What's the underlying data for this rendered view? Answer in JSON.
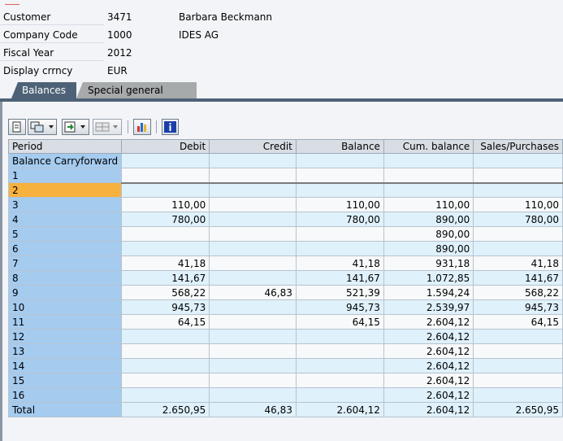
{
  "header": {
    "customer": {
      "label": "Customer",
      "value": "3471",
      "extra": "Barbara Beckmann"
    },
    "company_code": {
      "label": "Company Code",
      "value": "1000",
      "extra": "IDES AG"
    },
    "fiscal_year": {
      "label": "Fiscal Year",
      "value": "2012"
    },
    "display_currency": {
      "label": "Display crrncy",
      "value": "EUR"
    }
  },
  "tabs": [
    {
      "label": "Balances",
      "active": true
    },
    {
      "label": "Special general ledger",
      "active": false
    }
  ],
  "toolbar": {
    "icons": [
      "print-icon",
      "filter-icon",
      "export-icon",
      "layout-icon",
      "chart-icon",
      "info-icon"
    ]
  },
  "table": {
    "columns": [
      "Period",
      "Debit",
      "Credit",
      "Balance",
      "Cum. balance",
      "Sales/Purchases"
    ],
    "rows": [
      {
        "period": "Balance Carryforward",
        "debit": "",
        "credit": "",
        "balance": "",
        "cum": "",
        "sales": ""
      },
      {
        "period": "1",
        "debit": "",
        "credit": "",
        "balance": "",
        "cum": "",
        "sales": ""
      },
      {
        "period": "2",
        "debit": "",
        "credit": "",
        "balance": "",
        "cum": "",
        "sales": "",
        "selected": true
      },
      {
        "period": "3",
        "debit": "110,00",
        "credit": "",
        "balance": "110,00",
        "cum": "110,00",
        "sales": "110,00"
      },
      {
        "period": "4",
        "debit": "780,00",
        "credit": "",
        "balance": "780,00",
        "cum": "890,00",
        "sales": "780,00"
      },
      {
        "period": "5",
        "debit": "",
        "credit": "",
        "balance": "",
        "cum": "890,00",
        "sales": ""
      },
      {
        "period": "6",
        "debit": "",
        "credit": "",
        "balance": "",
        "cum": "890,00",
        "sales": ""
      },
      {
        "period": "7",
        "debit": "41,18",
        "credit": "",
        "balance": "41,18",
        "cum": "931,18",
        "sales": "41,18"
      },
      {
        "period": "8",
        "debit": "141,67",
        "credit": "",
        "balance": "141,67",
        "cum": "1.072,85",
        "sales": "141,67"
      },
      {
        "period": "9",
        "debit": "568,22",
        "credit": "46,83",
        "balance": "521,39",
        "cum": "1.594,24",
        "sales": "568,22"
      },
      {
        "period": "10",
        "debit": "945,73",
        "credit": "",
        "balance": "945,73",
        "cum": "2.539,97",
        "sales": "945,73"
      },
      {
        "period": "11",
        "debit": "64,15",
        "credit": "",
        "balance": "64,15",
        "cum": "2.604,12",
        "sales": "64,15"
      },
      {
        "period": "12",
        "debit": "",
        "credit": "",
        "balance": "",
        "cum": "2.604,12",
        "sales": ""
      },
      {
        "period": "13",
        "debit": "",
        "credit": "",
        "balance": "",
        "cum": "2.604,12",
        "sales": ""
      },
      {
        "period": "14",
        "debit": "",
        "credit": "",
        "balance": "",
        "cum": "2.604,12",
        "sales": ""
      },
      {
        "period": "15",
        "debit": "",
        "credit": "",
        "balance": "",
        "cum": "2.604,12",
        "sales": ""
      },
      {
        "period": "16",
        "debit": "",
        "credit": "",
        "balance": "",
        "cum": "2.604,12",
        "sales": ""
      },
      {
        "period": "Total",
        "debit": "2.650,95",
        "credit": "46,83",
        "balance": "2.604,12",
        "cum": "2.604,12",
        "sales": "2.650,95",
        "total": true
      }
    ]
  },
  "colors": {
    "period_column": "#a5cbef",
    "selected_row": "#f7b13f",
    "active_tab": "#4e6277"
  }
}
